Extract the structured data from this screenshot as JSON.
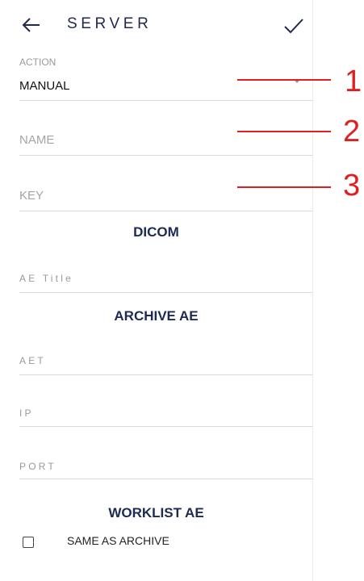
{
  "header": {
    "title": "SERVER",
    "back_icon": "arrow-left-icon",
    "confirm_icon": "check-icon"
  },
  "form": {
    "action": {
      "label": "ACTION",
      "value": "MANUAL"
    },
    "name_placeholder": "NAME",
    "key_placeholder": "KEY",
    "dicom_heading": "DICOM",
    "ae_title_placeholder": "AE Title",
    "archive_heading": "ARCHIVE AE",
    "aet_placeholder": "AET",
    "ip_placeholder": "IP",
    "port_placeholder": "PORT",
    "worklist_heading": "WORKLIST AE",
    "same_as_archive": {
      "label": "SAME AS ARCHIVE",
      "checked": false
    }
  },
  "annotations": [
    "1",
    "2",
    "3"
  ],
  "colors": {
    "accent": "#1c2a55",
    "annotation": "#e02020",
    "divider": "#d9d9d9"
  }
}
